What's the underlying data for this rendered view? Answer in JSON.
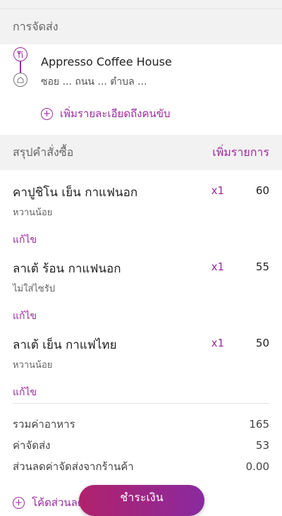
{
  "delivery": {
    "section_title": "การจัดส่ง",
    "restaurant_name": "Appresso Coffee House",
    "address": "ซอย ... ถนน ... ตำบล ...",
    "add_detail_label": "เพิ่มรายละเอียดถึงคนขับ"
  },
  "order": {
    "section_title": "สรุปคำสั่งซื้อ",
    "add_items_label": "เพิ่มรายการ",
    "items": [
      {
        "name": "คาปูชิโน เย็น กาแฟนอก",
        "note": "หวานน้อย",
        "qty": "x1",
        "price": "60",
        "edit": "แก้ไข"
      },
      {
        "name": "ลาเต้ ร้อน กาแฟนอก",
        "note": "ไม่ใส่ไซรัป",
        "qty": "x1",
        "price": "55",
        "edit": "แก้ไข"
      },
      {
        "name": "ลาเต้ เย็น กาแฟไทย",
        "note": "หวานน้อย",
        "qty": "x1",
        "price": "50",
        "edit": "แก้ไข"
      }
    ]
  },
  "summary": {
    "food_label": "รวมค่าอาหาร",
    "food_value": "165",
    "delivery_label": "ค่าจัดส่ง",
    "delivery_value": "53",
    "discount_label": "ส่วนลดค่าจัดส่งจากร้านค้า",
    "discount_value": "0.00"
  },
  "promo_label": "โค้ดส่วนลด",
  "pay_button_label": "ชำระเงิน",
  "colors": {
    "accent": "#9b2c9f"
  }
}
